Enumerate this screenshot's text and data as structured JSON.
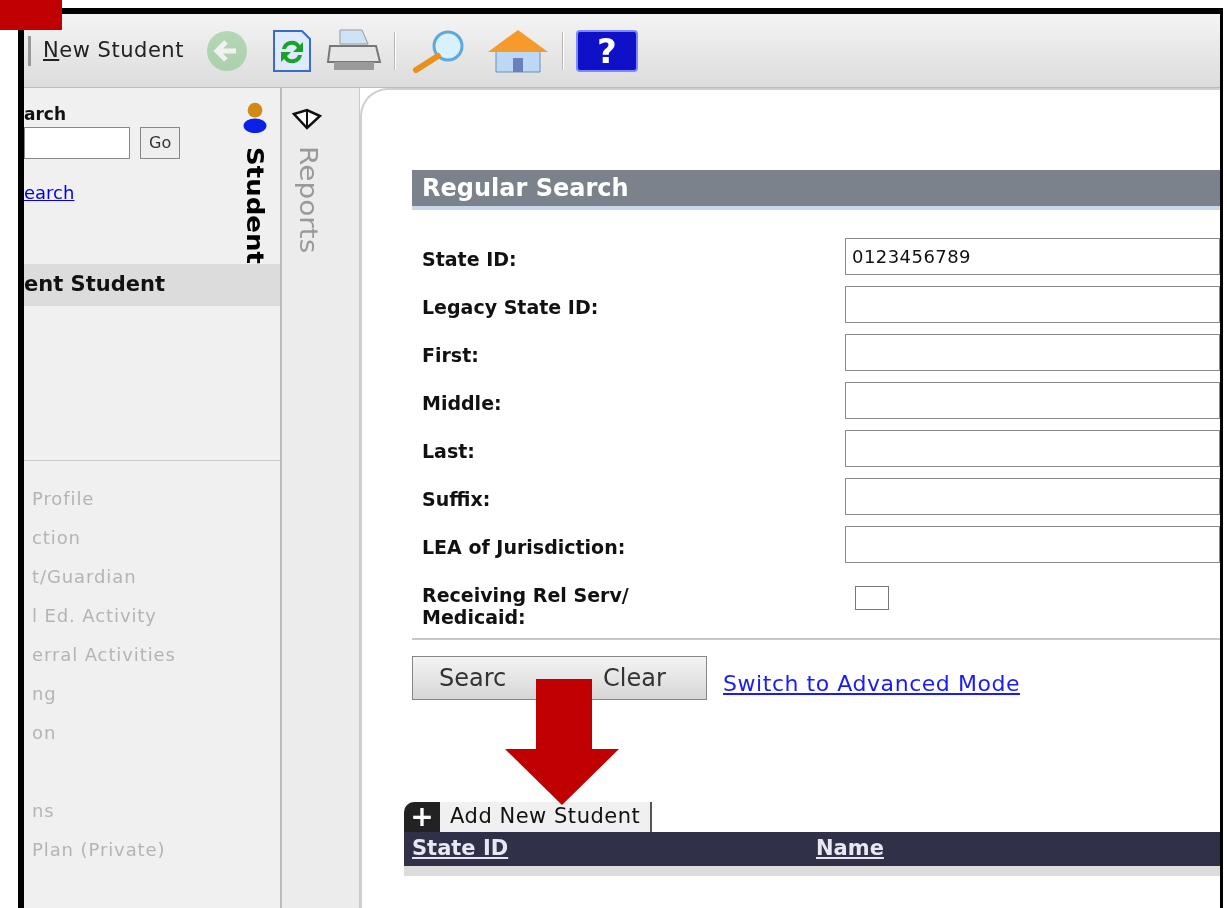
{
  "toolbar": {
    "title": "New Student",
    "tools": [
      {
        "kind": "back",
        "disabled": true
      },
      {
        "kind": "refresh",
        "disabled": false
      },
      {
        "kind": "print",
        "disabled": false
      },
      {
        "kind": "separator"
      },
      {
        "kind": "search",
        "disabled": false
      },
      {
        "kind": "home",
        "disabled": false
      },
      {
        "kind": "separator"
      },
      {
        "kind": "help",
        "glyph": "?",
        "disabled": false
      }
    ]
  },
  "sidebar": {
    "search_label": "arch",
    "go_button": "Go",
    "search_link": "earch",
    "tab": "Student",
    "current_student": "ent Student",
    "menu_groups": [
      [
        "Profile",
        "ction",
        "t/Guardian",
        "l Ed. Activity",
        "erral Activities",
        "ng",
        "on"
      ],
      [
        "ns",
        "Plan (Private)"
      ]
    ]
  },
  "side_tabs": [
    {
      "label": "Reports"
    }
  ],
  "search_panel": {
    "title": "Regular Search",
    "fields": [
      {
        "kind": "text",
        "label": "State ID:",
        "value": "0123456789"
      },
      {
        "kind": "text",
        "label": "Legacy State ID:"
      },
      {
        "kind": "text",
        "label": "First:"
      },
      {
        "kind": "text",
        "label": "Middle:"
      },
      {
        "kind": "text",
        "label": "Last:"
      },
      {
        "kind": "text",
        "label": "Suffix:"
      },
      {
        "kind": "text",
        "label": "LEA of Jurisdiction:"
      },
      {
        "kind": "checkbox",
        "label": "Receiving Rel Serv/\nMedicaid:",
        "checked": false
      }
    ],
    "buttons": [
      "Searc",
      "Clear"
    ],
    "advanced_link": "Switch to Advanced Mode"
  },
  "results": {
    "add_icon": "+",
    "add_label": "Add New Student",
    "columns": [
      "State ID",
      "Name"
    ]
  }
}
